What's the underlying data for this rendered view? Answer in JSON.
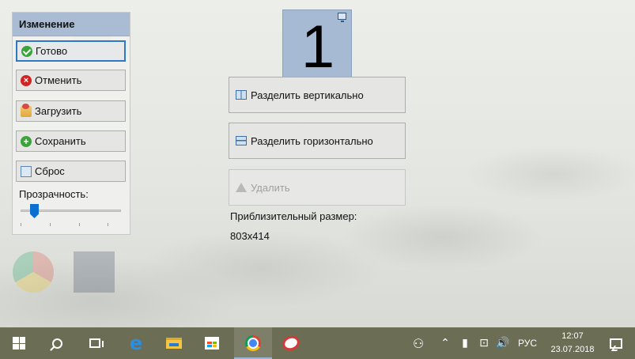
{
  "panel": {
    "title": "Изменение",
    "buttons": {
      "done": "Готово",
      "cancel": "Отменить",
      "load": "Загрузить",
      "save": "Сохранить",
      "reset": "Сброс"
    },
    "transparency_label": "Прозрачность:",
    "transparency_value": 0.1
  },
  "monitor": {
    "number": "1",
    "icon": "monitor-icon"
  },
  "actions": {
    "split_vertical": "Разделить вертикально",
    "split_horizontal": "Разделить горизонтально",
    "delete": "Удалить"
  },
  "size": {
    "label": "Приблизительный размер:",
    "value": "803x414"
  },
  "taskbar": {
    "icons": [
      "windows-start",
      "search",
      "task-view",
      "edge",
      "file-explorer",
      "store",
      "chrome",
      "app"
    ],
    "tray": [
      "people",
      "chevron-up",
      "battery",
      "network",
      "volume"
    ],
    "language": "РУС",
    "time": "12:07",
    "date": "23.07.2018"
  },
  "colors": {
    "panel_header": "#a9bcd3",
    "monitor": "#a6bbd3",
    "taskbar": "#6b6e55",
    "focus": "#2f78c4"
  }
}
